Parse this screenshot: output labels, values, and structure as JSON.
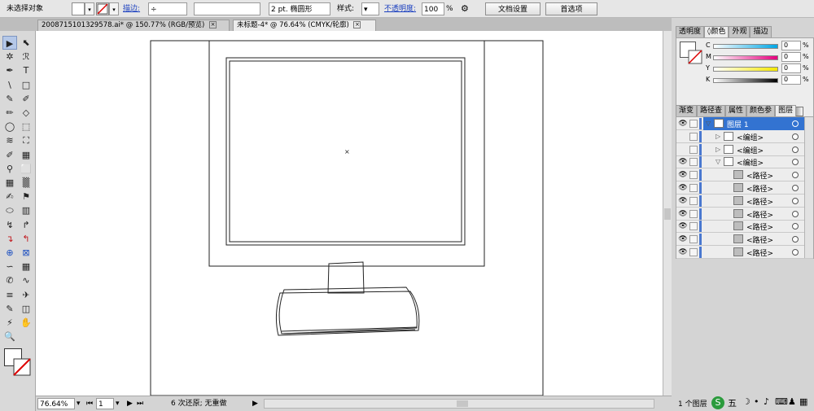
{
  "control_bar": {
    "selection_status": "未选择对象",
    "stroke_label": "描边:",
    "brush_size": "2 pt. 椭圆形",
    "style_label": "样式:",
    "opacity_label": "不透明度:",
    "opacity_value": "100",
    "opacity_unit": "%",
    "doc_setup_button": "文档设置",
    "preferences_button": "首选项"
  },
  "tabs": [
    {
      "label": "2008715101329578.ai* @ 150.77% (RGB/预览)",
      "active": false
    },
    {
      "label": "未标题-4* @ 76.64% (CMYK/轮廓)",
      "active": true
    }
  ],
  "tab_close_glyph": "×",
  "tools": [
    "▶",
    "⬉",
    "✲",
    "ℛ",
    "✒",
    "T",
    "\\",
    "□",
    "✎",
    "✐",
    "✏",
    "◇",
    "◯",
    "⬚",
    "≋",
    "⛶",
    "✐",
    "▦",
    "⚲",
    "⬜",
    "▦",
    "▒",
    "✍",
    "⚑",
    "⬭",
    "▥",
    "↯",
    "↱",
    "↴",
    "↰",
    "⊕",
    "⊠",
    "∽",
    "▦",
    "✆",
    "∿",
    "≡",
    "✈",
    "✎",
    "◫",
    "⚡",
    "✋",
    "🔍"
  ],
  "status_bar": {
    "zoom": "76.64%",
    "page": "1",
    "history": "6 次还原; 无重做"
  },
  "color_panel": {
    "tabs": [
      {
        "label": "透明度",
        "active": false
      },
      {
        "label": "◊颜色",
        "active": true
      },
      {
        "label": "外观",
        "active": false
      },
      {
        "label": "描边",
        "active": false
      }
    ],
    "channels": [
      {
        "name": "C",
        "value": "0",
        "unit": "%",
        "color": "#00a6e5"
      },
      {
        "name": "M",
        "value": "0",
        "unit": "%",
        "color": "#e5007e"
      },
      {
        "name": "Y",
        "value": "0",
        "unit": "%",
        "color": "#f4e800"
      },
      {
        "name": "K",
        "value": "0",
        "unit": "%",
        "color": "#000000"
      }
    ]
  },
  "layers_panel": {
    "tabs": [
      {
        "label": "渐变",
        "active": false
      },
      {
        "label": "路径查",
        "active": false
      },
      {
        "label": "属性",
        "active": false
      },
      {
        "label": "颜色参",
        "active": false
      },
      {
        "label": "图层",
        "active": true
      }
    ],
    "rows": [
      {
        "name": "图层 1",
        "indent": 0,
        "twirl": "▽",
        "eye": "👁",
        "highlight": true
      },
      {
        "name": "<编组>",
        "indent": 1,
        "twirl": "▷",
        "eye": "",
        "highlight": false
      },
      {
        "name": "<编组>",
        "indent": 1,
        "twirl": "▷",
        "eye": "",
        "highlight": false
      },
      {
        "name": "<编组>",
        "indent": 1,
        "twirl": "▽",
        "eye": "👁",
        "highlight": false
      },
      {
        "name": "<路径>",
        "indent": 2,
        "twirl": "",
        "eye": "👁",
        "highlight": false
      },
      {
        "name": "<路径>",
        "indent": 2,
        "twirl": "",
        "eye": "👁",
        "highlight": false
      },
      {
        "name": "<路径>",
        "indent": 2,
        "twirl": "",
        "eye": "👁",
        "highlight": false
      },
      {
        "name": "<路径>",
        "indent": 2,
        "twirl": "",
        "eye": "👁",
        "highlight": false
      },
      {
        "name": "<路径>",
        "indent": 2,
        "twirl": "",
        "eye": "👁",
        "highlight": false
      },
      {
        "name": "<路径>",
        "indent": 2,
        "twirl": "",
        "eye": "👁",
        "highlight": false
      },
      {
        "name": "<路径>",
        "indent": 2,
        "twirl": "",
        "eye": "👁",
        "highlight": false
      }
    ],
    "footer": "1 个图层"
  },
  "tray": {
    "ime": "五"
  },
  "colors": {
    "selection_blue": "#3373d1",
    "layer_bar": "#4a78d0",
    "link_blue": "#1a3fbf"
  }
}
